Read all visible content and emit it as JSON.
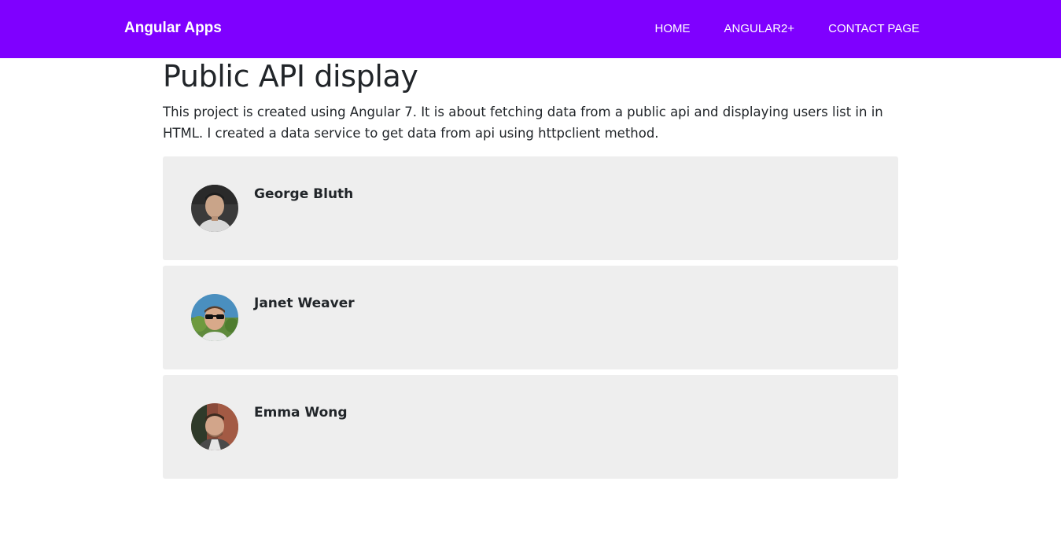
{
  "navbar": {
    "brand": "Angular Apps",
    "links": [
      {
        "label": "HOME"
      },
      {
        "label": "ANGULAR2+"
      },
      {
        "label": "CONTACT PAGE"
      }
    ],
    "background_color": "#7f00ff"
  },
  "main": {
    "title": "Public API display",
    "description": "This project is created using Angular 7. It is about fetching data from a public api and displaying users list in in HTML. I created a data service to get data from api using httpclient method.",
    "users": [
      {
        "name": "George Bluth",
        "avatar_icon": "user-photo"
      },
      {
        "name": "Janet Weaver",
        "avatar_icon": "user-photo"
      },
      {
        "name": "Emma Wong",
        "avatar_icon": "user-photo"
      }
    ],
    "card_background": "#eeeeee"
  }
}
